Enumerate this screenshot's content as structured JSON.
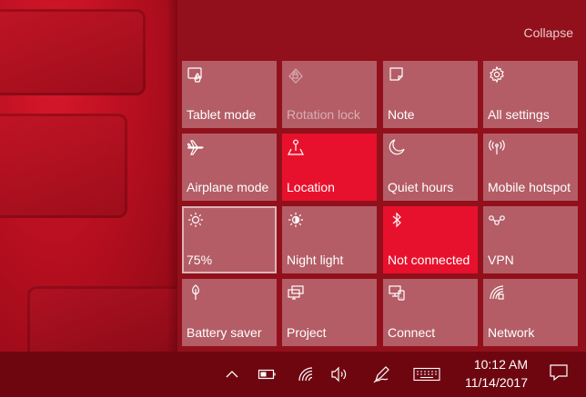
{
  "action_center": {
    "collapse_label": "Collapse",
    "tiles": [
      {
        "label": "Tablet mode",
        "icon": "tablet-mode-icon",
        "state": "off"
      },
      {
        "label": "Rotation lock",
        "icon": "rotation-lock-icon",
        "state": "disabled"
      },
      {
        "label": "Note",
        "icon": "note-icon",
        "state": "off"
      },
      {
        "label": "All settings",
        "icon": "gear-icon",
        "state": "off"
      },
      {
        "label": "Airplane mode",
        "icon": "airplane-icon",
        "state": "off"
      },
      {
        "label": "Location",
        "icon": "location-icon",
        "state": "on"
      },
      {
        "label": "Quiet hours",
        "icon": "moon-icon",
        "state": "off"
      },
      {
        "label": "Mobile hotspot",
        "icon": "hotspot-icon",
        "state": "off"
      },
      {
        "label": "75%",
        "icon": "brightness-icon",
        "state": "selected"
      },
      {
        "label": "Night light",
        "icon": "night-light-icon",
        "state": "off"
      },
      {
        "label": "Not connected",
        "icon": "bluetooth-icon",
        "state": "on"
      },
      {
        "label": "VPN",
        "icon": "vpn-icon",
        "state": "off"
      },
      {
        "label": "Battery saver",
        "icon": "battery-saver-icon",
        "state": "off"
      },
      {
        "label": "Project",
        "icon": "project-icon",
        "state": "off"
      },
      {
        "label": "Connect",
        "icon": "connect-icon",
        "state": "off"
      },
      {
        "label": "Network",
        "icon": "network-icon",
        "state": "off"
      }
    ]
  },
  "taskbar": {
    "time": "10:12 AM",
    "date": "11/14/2017",
    "tray_icons": [
      "chevron-up-icon",
      "battery-icon",
      "wifi-icon",
      "volume-icon",
      "pen-icon",
      "keyboard-icon"
    ],
    "notification_icon": "action-center-icon"
  },
  "colors": {
    "panel_bg": "#91101b",
    "tile_off": "#b45d66",
    "tile_on": "#e8112d",
    "taskbar_bg": "#6e0610"
  }
}
